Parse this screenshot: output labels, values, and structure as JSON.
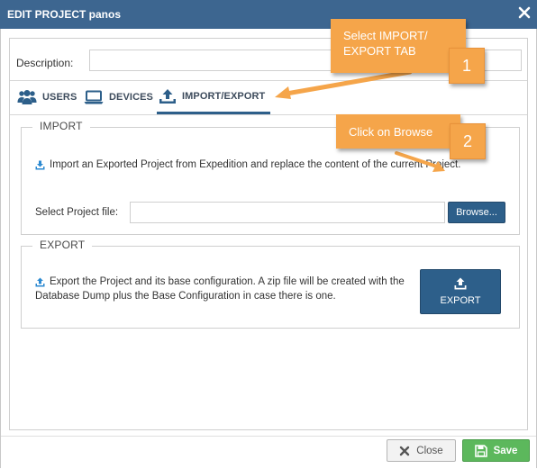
{
  "dialog": {
    "title": "EDIT PROJECT panos"
  },
  "description": {
    "label": "Description:",
    "value": ""
  },
  "tabs": [
    {
      "label": "USERS",
      "icon": "users-icon"
    },
    {
      "label": "DEVICES",
      "icon": "laptop-icon"
    },
    {
      "label": "IMPORT/EXPORT",
      "icon": "upload-icon",
      "active": true
    }
  ],
  "import": {
    "title": "IMPORT",
    "description": "Import an Exported Project from Expedition and replace the content of the current Project.",
    "file_label": "Select Project file:",
    "file_value": "",
    "browse_label": "Browse..."
  },
  "export": {
    "title": "EXPORT",
    "description_line1": "Export the Project and its base configuration. A zip file will be created with the",
    "description_line2": "Database Dump plus the Base Configuration in case there is one.",
    "button_label": "EXPORT"
  },
  "footer": {
    "close_label": "Close",
    "save_label": "Save"
  },
  "annotations": {
    "callout1_line1": "Select IMPORT/",
    "callout1_line2": "EXPORT TAB",
    "badge1": "1",
    "callout2": "Click on Browse",
    "badge2": "2"
  },
  "colors": {
    "titlebar": "#3d6690",
    "primary": "#2d5f8a",
    "success": "#5cb85c",
    "callout": "#f5a54a"
  }
}
